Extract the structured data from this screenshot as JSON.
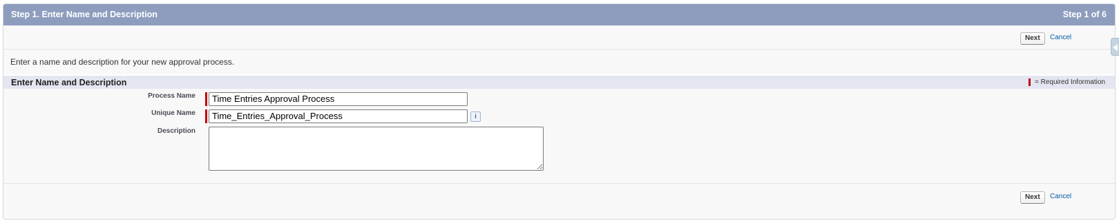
{
  "header": {
    "title": "Step 1. Enter Name and Description",
    "step": "Step 1 of 6"
  },
  "top_buttons": {
    "next_label": "Next",
    "cancel_label": "Cancel"
  },
  "intro_text": "Enter a name and description for your new approval process.",
  "section": {
    "title": "Enter Name and Description",
    "required_info": "= Required Information"
  },
  "fields": {
    "process_name": {
      "label": "Process Name",
      "value": "Time Entries Approval Process"
    },
    "unique_name": {
      "label": "Unique Name",
      "value": "Time_Entries_Approval_Process"
    },
    "description": {
      "label": "Description",
      "value": ""
    }
  },
  "bottom_buttons": {
    "next_label": "Next",
    "cancel_label": "Cancel"
  },
  "icons": {
    "info": "info-icon",
    "side_tab": "collapse-arrow-icon"
  },
  "colors": {
    "header_bg": "#8e9dbe",
    "section_bg": "#e3e6f0",
    "required": "#c00000",
    "link": "#015ba7"
  }
}
